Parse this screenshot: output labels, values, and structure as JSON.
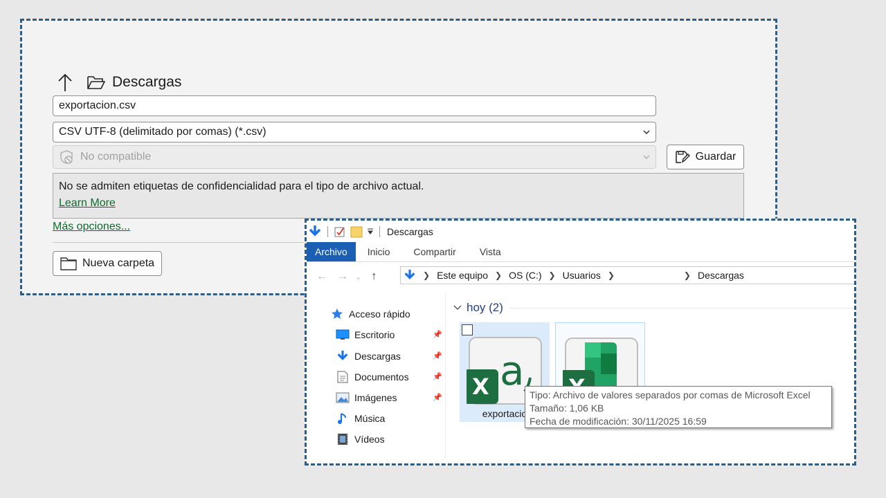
{
  "save_dialog": {
    "location": "Descargas",
    "filename": "exportacion.csv",
    "file_type": "CSV UTF-8 (delimitado por comas) (*.csv)",
    "sensitivity": "No compatible",
    "save_button": "Guardar",
    "info_message": "No se admiten etiquetas de confidencialidad para el tipo de archivo actual.",
    "learn_more": "Learn More",
    "more_options": "Más opciones...",
    "new_folder": "Nueva carpeta"
  },
  "explorer": {
    "title": "Descargas",
    "ribbon_tabs": [
      "Archivo",
      "Inicio",
      "Compartir",
      "Vista"
    ],
    "breadcrumb": [
      "Este equipo",
      "OS (C:)",
      "Usuarios",
      "",
      "Descargas"
    ],
    "nav_items": [
      {
        "label": "Acceso rápido",
        "icon": "star-icon"
      },
      {
        "label": "Escritorio",
        "icon": "desktop-icon"
      },
      {
        "label": "Descargas",
        "icon": "download-icon"
      },
      {
        "label": "Documentos",
        "icon": "document-icon"
      },
      {
        "label": "Imágenes",
        "icon": "image-icon"
      },
      {
        "label": "Música",
        "icon": "music-icon"
      },
      {
        "label": "Vídeos",
        "icon": "video-icon"
      }
    ],
    "group_header": "hoy (2)",
    "files": [
      {
        "label": "exportacio",
        "icon": "csv-excel-icon"
      },
      {
        "label": "",
        "icon": "excel-icon"
      }
    ],
    "tooltip": {
      "type": "Tipo: Archivo de valores separados por comas de Microsoft Excel",
      "size": "Tamaño: 1,06 KB",
      "modified": "Fecha de modificación: 30/11/2025 16:59"
    }
  },
  "colors": {
    "accent_blue": "#1a5fb4",
    "link_green": "#0b6b2b",
    "excel_green": "#1d6f42",
    "dashed_border": "#2c5d84"
  }
}
